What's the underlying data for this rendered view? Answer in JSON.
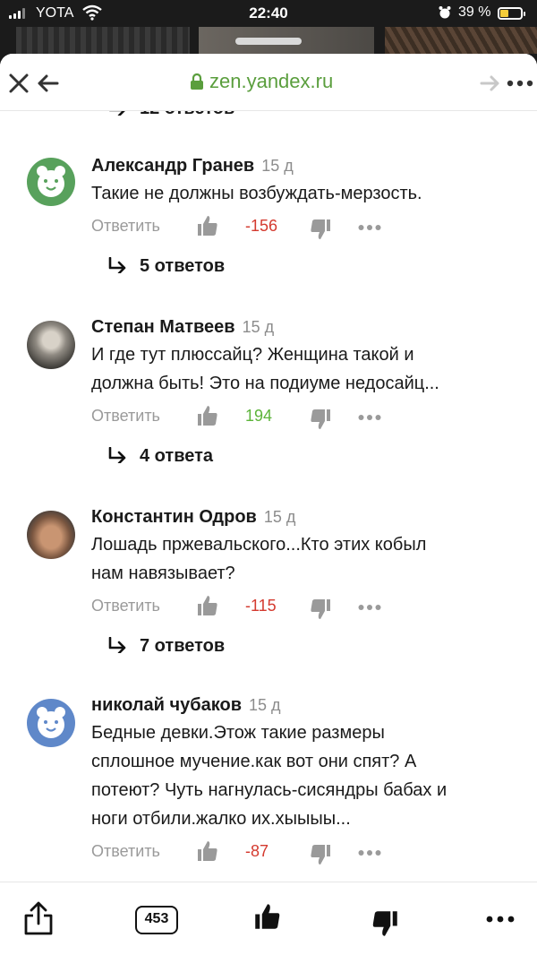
{
  "status_bar": {
    "carrier": "YOTA",
    "time": "22:40",
    "battery_percent": "39 %",
    "battery_level": 0.39
  },
  "browser": {
    "url": "zen.yandex.ru"
  },
  "comments_section": {
    "top_partial_replies": "12 ответов",
    "reply_label": "Ответить",
    "comments": [
      {
        "author": "Александр Гранев",
        "time": "15 д",
        "text_lines": [
          "Такие не должны возбуждать-мерзость."
        ],
        "score": "-156",
        "replies": "5 ответов"
      },
      {
        "author": "Степан Матвеев",
        "time": "15 д",
        "text_lines": [
          "И где тут плюссайц? Женщина такой и",
          "должна быть! Это на подиуме недосайц..."
        ],
        "score": "194",
        "replies": "4 ответа"
      },
      {
        "author": "Константин Одров",
        "time": "15 д",
        "text_lines": [
          "Лошадь пржевальского...Кто этих кобыл",
          "нам навязывает?"
        ],
        "score": "-115",
        "replies": "7 ответов"
      },
      {
        "author": "николай чубаков",
        "time": "15 д",
        "text_lines": [
          "Бедные девки.Этож такие размеры",
          "сплошное мучение.как вот они спят? А",
          "потеют? Чуть нагнулась-сисяндры бабах и",
          "ноги отбили.жалко их.хыыыы..."
        ],
        "score": "-87",
        "replies": ""
      }
    ]
  },
  "toolbar": {
    "comments_count": "453"
  },
  "colors": {
    "url_green": "#5a9e3d",
    "negative_score": "#d43a2f",
    "positive_score": "#5cb43a"
  },
  "icons": [
    "signal-icon",
    "wifi-icon",
    "alarm-icon",
    "battery-icon",
    "close-icon",
    "back-arrow-icon",
    "lock-icon",
    "forward-arrow-icon",
    "more-dots-icon",
    "bear-avatar-icon",
    "like-icon",
    "dislike-icon",
    "reply-arrow-icon",
    "share-icon"
  ]
}
